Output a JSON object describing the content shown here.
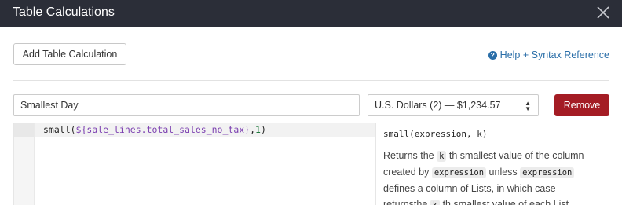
{
  "dialog": {
    "title": "Table Calculations",
    "close_icon": "close-icon"
  },
  "toolbar": {
    "add_label": "Add Table Calculation",
    "help_icon": "question-circle-icon",
    "help_label": "Help + Syntax Reference"
  },
  "calculation": {
    "name_value": "Smallest Day",
    "format_value": "U.S. Dollars (2) — $1,234.57",
    "remove_label": "Remove",
    "remove_color": "#a41c24"
  },
  "editor": {
    "code_func_open": "small(",
    "code_field": "${sale_lines.total_sales_no_tax}",
    "code_comma": ",",
    "code_arg": "1",
    "code_close": ")"
  },
  "reference": {
    "signature": "small(expression, k)",
    "desc_1": "Returns the ",
    "code_k_1": "k",
    "desc_2": " th smallest value of the column created by ",
    "code_expr_1": "expression",
    "desc_3": " unless ",
    "code_expr_2": "expression",
    "desc_4": " defines a column of Lists, in which case returnsthe ",
    "code_k_2": "k",
    "desc_5": " th smallest value of each List"
  },
  "colors": {
    "header_bg": "#2b2e38",
    "link": "#2a6ea8",
    "field_token": "#7b3fb0",
    "number_token": "#1e7a3c"
  }
}
